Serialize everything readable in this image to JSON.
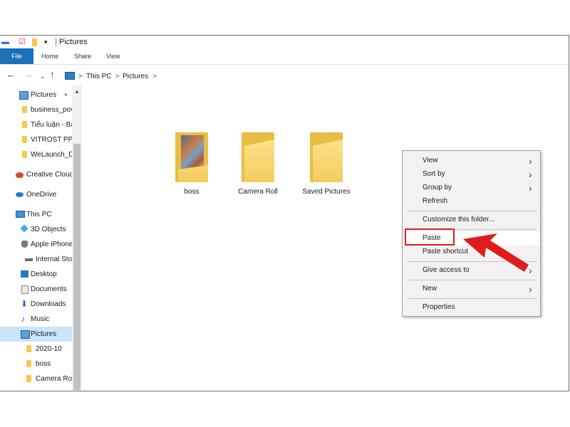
{
  "window": {
    "title": "Pictures"
  },
  "quick_access": {
    "properties_icon": "properties-icon",
    "folder_icon": "new-folder-icon",
    "dropdown": "▾"
  },
  "ribbon": {
    "tabs": [
      "File",
      "Home",
      "Share",
      "View"
    ],
    "active_tab_color": "#1c6fb9"
  },
  "address": {
    "icons": [
      "back-arrow-icon",
      "forward-arrow-icon",
      "recent-dropdown-icon",
      "up-arrow-icon"
    ],
    "breadcrumb": [
      "This PC",
      "Pictures"
    ],
    "separator": ">"
  },
  "sidebar": {
    "items": [
      {
        "label": "Pictures",
        "icon": "pictures-icon",
        "pinned": true
      },
      {
        "label": "business_pov",
        "icon": "folder-icon"
      },
      {
        "label": "Tiểu luận - Bả",
        "icon": "folder-icon"
      },
      {
        "label": "VITROST PPT",
        "icon": "folder-icon"
      },
      {
        "label": "WeLaunch_D",
        "icon": "folder-icon"
      },
      {
        "label": "Creative Cloud",
        "icon": "creative-cloud-icon"
      },
      {
        "label": "OneDrive",
        "icon": "onedrive-icon"
      },
      {
        "label": "This PC",
        "icon": "this-pc-icon"
      },
      {
        "label": "3D Objects",
        "icon": "3d-objects-icon"
      },
      {
        "label": "Apple iPhone",
        "icon": "iphone-icon"
      },
      {
        "label": "Internal Sto",
        "icon": "drive-icon"
      },
      {
        "label": "Desktop",
        "icon": "desktop-icon"
      },
      {
        "label": "Documents",
        "icon": "documents-icon"
      },
      {
        "label": "Downloads",
        "icon": "downloads-icon"
      },
      {
        "label": "Music",
        "icon": "music-icon"
      },
      {
        "label": "Pictures",
        "icon": "pictures-icon",
        "selected": true
      },
      {
        "label": "2020-10",
        "icon": "folder-icon"
      },
      {
        "label": "boss",
        "icon": "folder-icon"
      },
      {
        "label": "Camera Rol",
        "icon": "folder-icon"
      }
    ],
    "pin_glyph": "✦"
  },
  "content": {
    "folders": [
      {
        "name": "boss",
        "has_preview": true
      },
      {
        "name": "Camera Roll",
        "has_preview": false
      },
      {
        "name": "Saved Pictures",
        "has_preview": false
      }
    ]
  },
  "context_menu": {
    "items": [
      {
        "label": "View",
        "submenu": true
      },
      {
        "label": "Sort by",
        "submenu": true
      },
      {
        "label": "Group by",
        "submenu": true
      },
      {
        "label": "Refresh",
        "submenu": false
      },
      {
        "label": "Customize this folder...",
        "submenu": false
      },
      {
        "label": "Paste",
        "submenu": false,
        "highlighted": true
      },
      {
        "label": "Paste shortcut",
        "submenu": false
      },
      {
        "label": "Give access to",
        "submenu": true
      },
      {
        "label": "New",
        "submenu": true
      },
      {
        "label": "Properties",
        "submenu": false
      }
    ],
    "submenu_glyph": "›"
  },
  "annotation": {
    "highlight_color": "#e01c1c",
    "target": "Paste"
  }
}
